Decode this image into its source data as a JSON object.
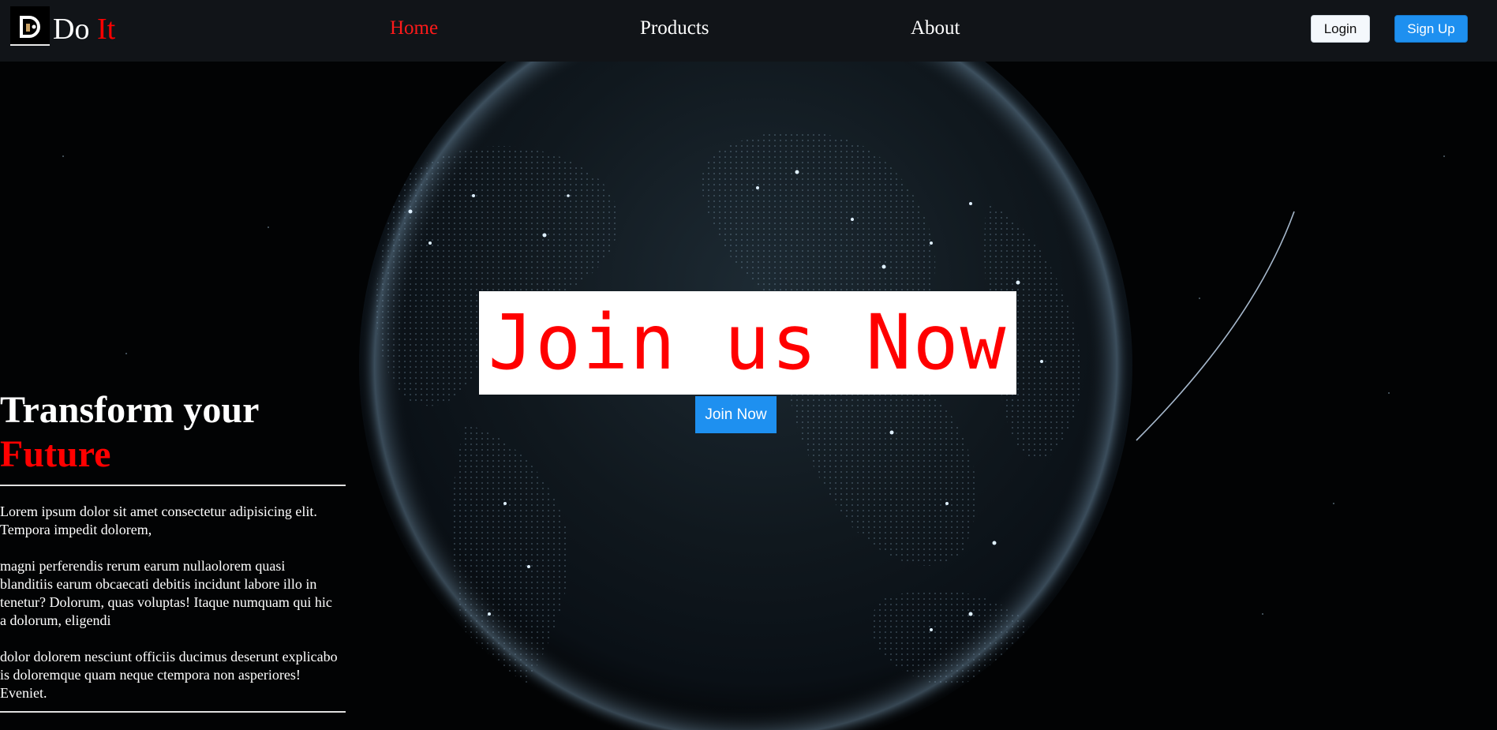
{
  "navbar": {
    "logo_letter": "D",
    "brand_prefix": "Do",
    "brand_accent": "It",
    "links": [
      {
        "label": "Home",
        "active": true
      },
      {
        "label": "Products",
        "active": false
      },
      {
        "label": "About",
        "active": false
      }
    ],
    "login_label": "Login",
    "signup_label": "Sign Up"
  },
  "hero": {
    "banner_text": "Join us Now",
    "cta_label": "Join Now",
    "headline_line1": "Transform your",
    "headline_line2": "Future",
    "paragraphs": [
      "Lorem ipsum dolor sit amet consectetur adipisicing elit. Tempora impedit dolorem,",
      "magni perferendis rerum earum nullaolorem quasi blanditiis earum obcaecati debitis incidunt labore illo in tenetur? Dolorum, quas voluptas! Itaque numquam qui hic a dolorum, eligendi",
      "dolor dolorem nesciunt officiis ducimus deserunt explicabo is doloremque quam neque ctempora non asperiores! Eveniet."
    ]
  },
  "colors": {
    "accent_red": "#ff0000",
    "primary_blue": "#1e90f0",
    "navbar_bg": "#111418"
  },
  "icons": {
    "logo": "stylized-d-logo-icon",
    "background": "digital-earth-globe-image"
  }
}
